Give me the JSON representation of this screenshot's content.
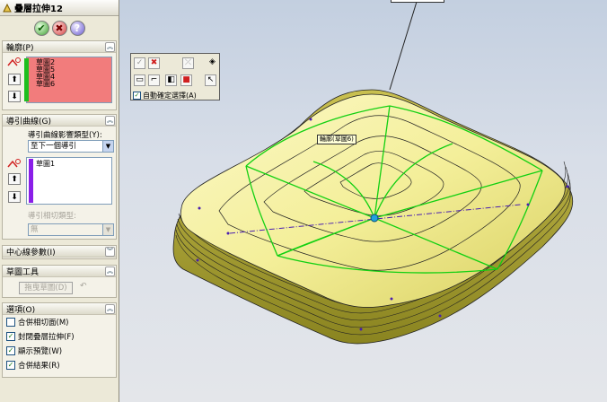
{
  "panel": {
    "title": "疊層拉伸12",
    "profiles": {
      "header": "輪廓(P)",
      "items": [
        "草圖2",
        "草圖5",
        "草圖4",
        "草圖6"
      ]
    },
    "guides": {
      "header": "導引曲線(G)",
      "influence_label": "導引曲線影響類型(Y):",
      "influence_value": "至下一個導引",
      "items": [
        "草圖1"
      ],
      "tangency_label": "導引相切類型:",
      "tangency_value": "無"
    },
    "centerline": {
      "header": "中心線參數(I)"
    },
    "sketch_tools": {
      "header": "草圖工具",
      "drag_button": "拖曳草圖(D)"
    },
    "options": {
      "header": "選項(O)",
      "items": [
        {
          "label": "合併相切面(M)",
          "checked": false
        },
        {
          "label": "封閉疊層拉伸(F)",
          "checked": true
        },
        {
          "label": "顯示預覽(W)",
          "checked": true
        },
        {
          "label": "合併結果(R)",
          "checked": true
        }
      ]
    }
  },
  "floating_toolbar": {
    "auto_select_label": "自動確定選擇(A)",
    "auto_select_checked": true
  },
  "viewport": {
    "tag": "輪廓(草圖6)"
  },
  "colors": {
    "profile_list_bg": "#f27c7c",
    "profile_bar": "#1ebf1e",
    "guide_bar": "#8a1ee8",
    "surface": "#f4f0a0",
    "guide_lines": "#12d012",
    "edges": "#4a1fb0"
  }
}
